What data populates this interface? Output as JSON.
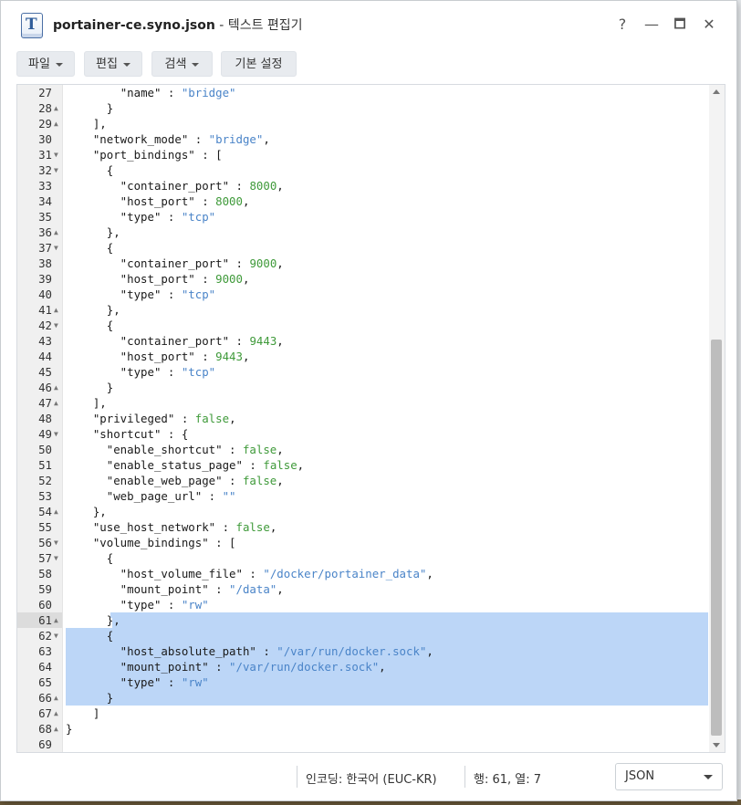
{
  "window": {
    "title_file": "portainer-ce.syno.json",
    "title_rest": " - 텍스트 편집기",
    "help_label": "?",
    "minimize_label": "—",
    "maximize_label": "🗖",
    "close_label": "✕"
  },
  "toolbar": {
    "file_label": "파일",
    "edit_label": "편집",
    "search_label": "검색",
    "settings_label": "기본 설정"
  },
  "editor": {
    "lines": [
      {
        "n": "27",
        "fold": "",
        "code": [
          [
            "",
            "        "
          ],
          [
            "",
            "\"name\""
          ],
          [
            "",
            " : "
          ],
          [
            "s",
            "\"bridge\""
          ]
        ]
      },
      {
        "n": "28",
        "fold": "▲",
        "code": [
          [
            "",
            "      }"
          ]
        ]
      },
      {
        "n": "29",
        "fold": "▲",
        "code": [
          [
            "",
            "    ],"
          ]
        ]
      },
      {
        "n": "30",
        "fold": "",
        "code": [
          [
            "",
            "    \"network_mode\""
          ],
          [
            "",
            " : "
          ],
          [
            "s",
            "\"bridge\""
          ],
          [
            "",
            ","
          ]
        ]
      },
      {
        "n": "31",
        "fold": "▼",
        "code": [
          [
            "",
            "    \"port_bindings\""
          ],
          [
            "",
            " : ["
          ]
        ]
      },
      {
        "n": "32",
        "fold": "▼",
        "code": [
          [
            "",
            "      {"
          ]
        ]
      },
      {
        "n": "33",
        "fold": "",
        "code": [
          [
            "",
            "        \"container_port\""
          ],
          [
            "",
            " : "
          ],
          [
            "n",
            "8000"
          ],
          [
            "",
            ","
          ]
        ]
      },
      {
        "n": "34",
        "fold": "",
        "code": [
          [
            "",
            "        \"host_port\""
          ],
          [
            "",
            " : "
          ],
          [
            "n",
            "8000"
          ],
          [
            "",
            ","
          ]
        ]
      },
      {
        "n": "35",
        "fold": "",
        "code": [
          [
            "",
            "        \"type\""
          ],
          [
            "",
            " : "
          ],
          [
            "s",
            "\"tcp\""
          ]
        ]
      },
      {
        "n": "36",
        "fold": "▲",
        "code": [
          [
            "",
            "      },"
          ]
        ]
      },
      {
        "n": "37",
        "fold": "▼",
        "code": [
          [
            "",
            "      {"
          ]
        ]
      },
      {
        "n": "38",
        "fold": "",
        "code": [
          [
            "",
            "        \"container_port\""
          ],
          [
            "",
            " : "
          ],
          [
            "n",
            "9000"
          ],
          [
            "",
            ","
          ]
        ]
      },
      {
        "n": "39",
        "fold": "",
        "code": [
          [
            "",
            "        \"host_port\""
          ],
          [
            "",
            " : "
          ],
          [
            "n",
            "9000"
          ],
          [
            "",
            ","
          ]
        ]
      },
      {
        "n": "40",
        "fold": "",
        "code": [
          [
            "",
            "        \"type\""
          ],
          [
            "",
            " : "
          ],
          [
            "s",
            "\"tcp\""
          ]
        ]
      },
      {
        "n": "41",
        "fold": "▲",
        "code": [
          [
            "",
            "      },"
          ]
        ]
      },
      {
        "n": "42",
        "fold": "▼",
        "code": [
          [
            "",
            "      {"
          ]
        ]
      },
      {
        "n": "43",
        "fold": "",
        "code": [
          [
            "",
            "        \"container_port\""
          ],
          [
            "",
            " : "
          ],
          [
            "n",
            "9443"
          ],
          [
            "",
            ","
          ]
        ]
      },
      {
        "n": "44",
        "fold": "",
        "code": [
          [
            "",
            "        \"host_port\""
          ],
          [
            "",
            " : "
          ],
          [
            "n",
            "9443"
          ],
          [
            "",
            ","
          ]
        ]
      },
      {
        "n": "45",
        "fold": "",
        "code": [
          [
            "",
            "        \"type\""
          ],
          [
            "",
            " : "
          ],
          [
            "s",
            "\"tcp\""
          ]
        ]
      },
      {
        "n": "46",
        "fold": "▲",
        "code": [
          [
            "",
            "      }"
          ]
        ]
      },
      {
        "n": "47",
        "fold": "▲",
        "code": [
          [
            "",
            "    ],"
          ]
        ]
      },
      {
        "n": "48",
        "fold": "",
        "code": [
          [
            "",
            "    \"privileged\""
          ],
          [
            "",
            " : "
          ],
          [
            "k",
            "false"
          ],
          [
            "",
            ","
          ]
        ]
      },
      {
        "n": "49",
        "fold": "▼",
        "code": [
          [
            "",
            "    \"shortcut\""
          ],
          [
            "",
            " : {"
          ]
        ]
      },
      {
        "n": "50",
        "fold": "",
        "code": [
          [
            "",
            "      \"enable_shortcut\""
          ],
          [
            "",
            " : "
          ],
          [
            "k",
            "false"
          ],
          [
            "",
            ","
          ]
        ]
      },
      {
        "n": "51",
        "fold": "",
        "code": [
          [
            "",
            "      \"enable_status_page\""
          ],
          [
            "",
            " : "
          ],
          [
            "k",
            "false"
          ],
          [
            "",
            ","
          ]
        ]
      },
      {
        "n": "52",
        "fold": "",
        "code": [
          [
            "",
            "      \"enable_web_page\""
          ],
          [
            "",
            " : "
          ],
          [
            "k",
            "false"
          ],
          [
            "",
            ","
          ]
        ]
      },
      {
        "n": "53",
        "fold": "",
        "code": [
          [
            "",
            "      \"web_page_url\""
          ],
          [
            "",
            " : "
          ],
          [
            "s",
            "\"\""
          ]
        ]
      },
      {
        "n": "54",
        "fold": "▲",
        "code": [
          [
            "",
            "    },"
          ]
        ]
      },
      {
        "n": "55",
        "fold": "",
        "code": [
          [
            "",
            "    \"use_host_network\""
          ],
          [
            "",
            " : "
          ],
          [
            "k",
            "false"
          ],
          [
            "",
            ","
          ]
        ]
      },
      {
        "n": "56",
        "fold": "▼",
        "code": [
          [
            "",
            "    \"volume_bindings\""
          ],
          [
            "",
            " : ["
          ]
        ]
      },
      {
        "n": "57",
        "fold": "▼",
        "code": [
          [
            "",
            "      {"
          ]
        ]
      },
      {
        "n": "58",
        "fold": "",
        "code": [
          [
            "",
            "        \"host_volume_file\""
          ],
          [
            "",
            " : "
          ],
          [
            "s",
            "\"/docker/portainer_data\""
          ],
          [
            "",
            ","
          ]
        ]
      },
      {
        "n": "59",
        "fold": "",
        "code": [
          [
            "",
            "        \"mount_point\""
          ],
          [
            "",
            " : "
          ],
          [
            "s",
            "\"/data\""
          ],
          [
            "",
            ","
          ]
        ]
      },
      {
        "n": "60",
        "fold": "",
        "code": [
          [
            "",
            "        \"type\""
          ],
          [
            "",
            " : "
          ],
          [
            "s",
            "\"rw\""
          ]
        ]
      },
      {
        "n": "61",
        "fold": "▲",
        "code": [
          [
            "",
            "      },"
          ]
        ]
      },
      {
        "n": "62",
        "fold": "▼",
        "code": [
          [
            "",
            "      {"
          ]
        ]
      },
      {
        "n": "63",
        "fold": "",
        "code": [
          [
            "",
            "        \"host_absolute_path\""
          ],
          [
            "",
            " : "
          ],
          [
            "s",
            "\"/var/run/docker.sock\""
          ],
          [
            "",
            ","
          ]
        ]
      },
      {
        "n": "64",
        "fold": "",
        "code": [
          [
            "",
            "        \"mount_point\""
          ],
          [
            "",
            " : "
          ],
          [
            "s",
            "\"/var/run/docker.sock\""
          ],
          [
            "",
            ","
          ]
        ]
      },
      {
        "n": "65",
        "fold": "",
        "code": [
          [
            "",
            "        \"type\""
          ],
          [
            "",
            " : "
          ],
          [
            "s",
            "\"rw\""
          ]
        ]
      },
      {
        "n": "66",
        "fold": "▲",
        "code": [
          [
            "",
            "      }"
          ]
        ]
      },
      {
        "n": "67",
        "fold": "▲",
        "code": [
          [
            "",
            "    ]"
          ]
        ]
      },
      {
        "n": "68",
        "fold": "▲",
        "code": [
          [
            "",
            "}"
          ]
        ]
      },
      {
        "n": "69",
        "fold": "",
        "code": [
          [
            "",
            ""
          ]
        ]
      }
    ],
    "active_line": "61",
    "selected_from": "61",
    "selected_to": "66"
  },
  "status": {
    "encoding": "인코딩: 한국어 (EUC-KR)",
    "position": "행: 61, 열: 7",
    "language": "JSON"
  }
}
